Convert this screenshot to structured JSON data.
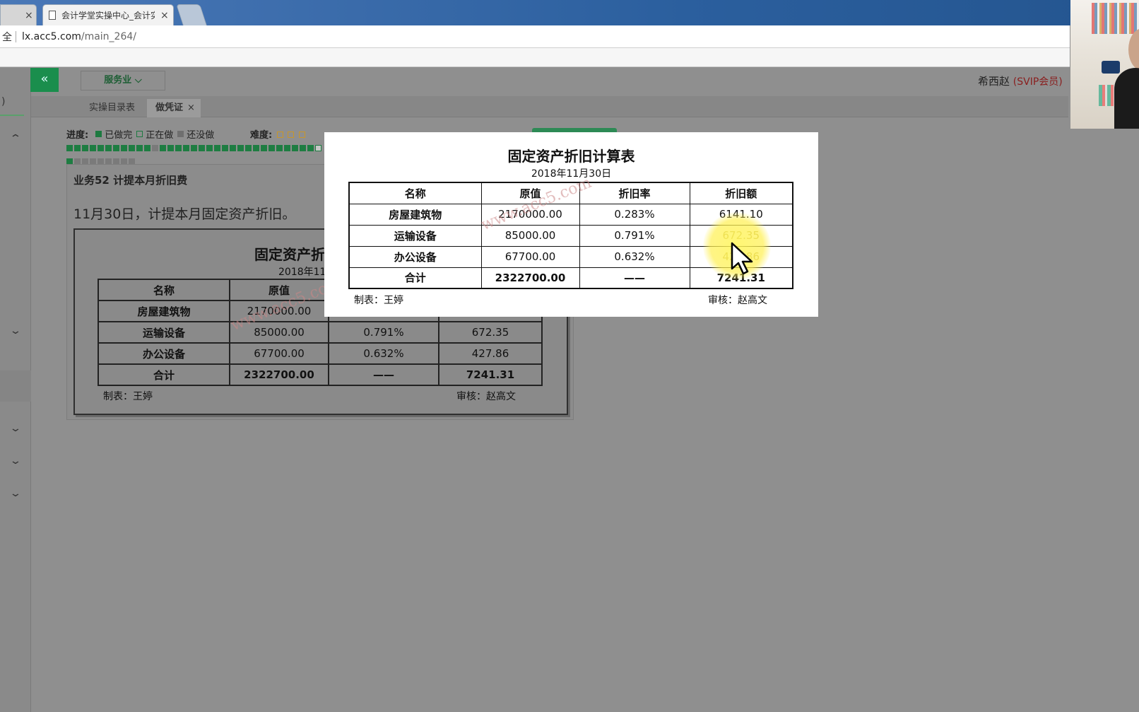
{
  "browser": {
    "tabs": [
      {
        "label": "",
        "close": "×"
      },
      {
        "label": "会计学堂实操中心_会计实操",
        "close": "×"
      }
    ],
    "address": {
      "safe_label": "全",
      "host": "lx.acc5.com",
      "path": "/main_264/"
    }
  },
  "header": {
    "collapse_icon": "«",
    "industry_label": "服务业",
    "industry_caret": "⌵",
    "user_name": "希西赵",
    "user_level": "(SVIP会员)"
  },
  "leftrail": {
    "paren": ")",
    "up": "⌃",
    "down": "⌄"
  },
  "subtabs": {
    "catalog": "实操目录表",
    "voucher": "做凭证",
    "close": "×"
  },
  "progress": {
    "label": "进度:",
    "done": "已做完",
    "doing": "正在做",
    "todo": "还没做",
    "difficulty_label": "难度:"
  },
  "business": {
    "title": "业务52 计提本月折旧费",
    "description": "11月30日，计提本月固定资产折旧。"
  },
  "sheet": {
    "title": "固定资产折旧计算表",
    "title_partial": "固定资产折",
    "date": "2018年11月30日",
    "date_partial": "2018年11",
    "watermark": "www.acc5.com",
    "headers": [
      "名称",
      "原值",
      "折旧率",
      "折旧额"
    ],
    "rows": [
      {
        "name": "房屋建筑物",
        "original": "2170000.00",
        "rate": "0.283%",
        "amount": "6141.10"
      },
      {
        "name": "运输设备",
        "original": "85000.00",
        "rate": "0.791%",
        "amount": "672.35"
      },
      {
        "name": "办公设备",
        "original": "67700.00",
        "rate": "0.632%",
        "amount": "427.86"
      }
    ],
    "total": {
      "name": "合计",
      "original": "2322700.00",
      "rate": "——",
      "amount": "7241.31"
    },
    "prepared_by": "制表：王婷",
    "reviewed_by": "审核：赵高文"
  }
}
